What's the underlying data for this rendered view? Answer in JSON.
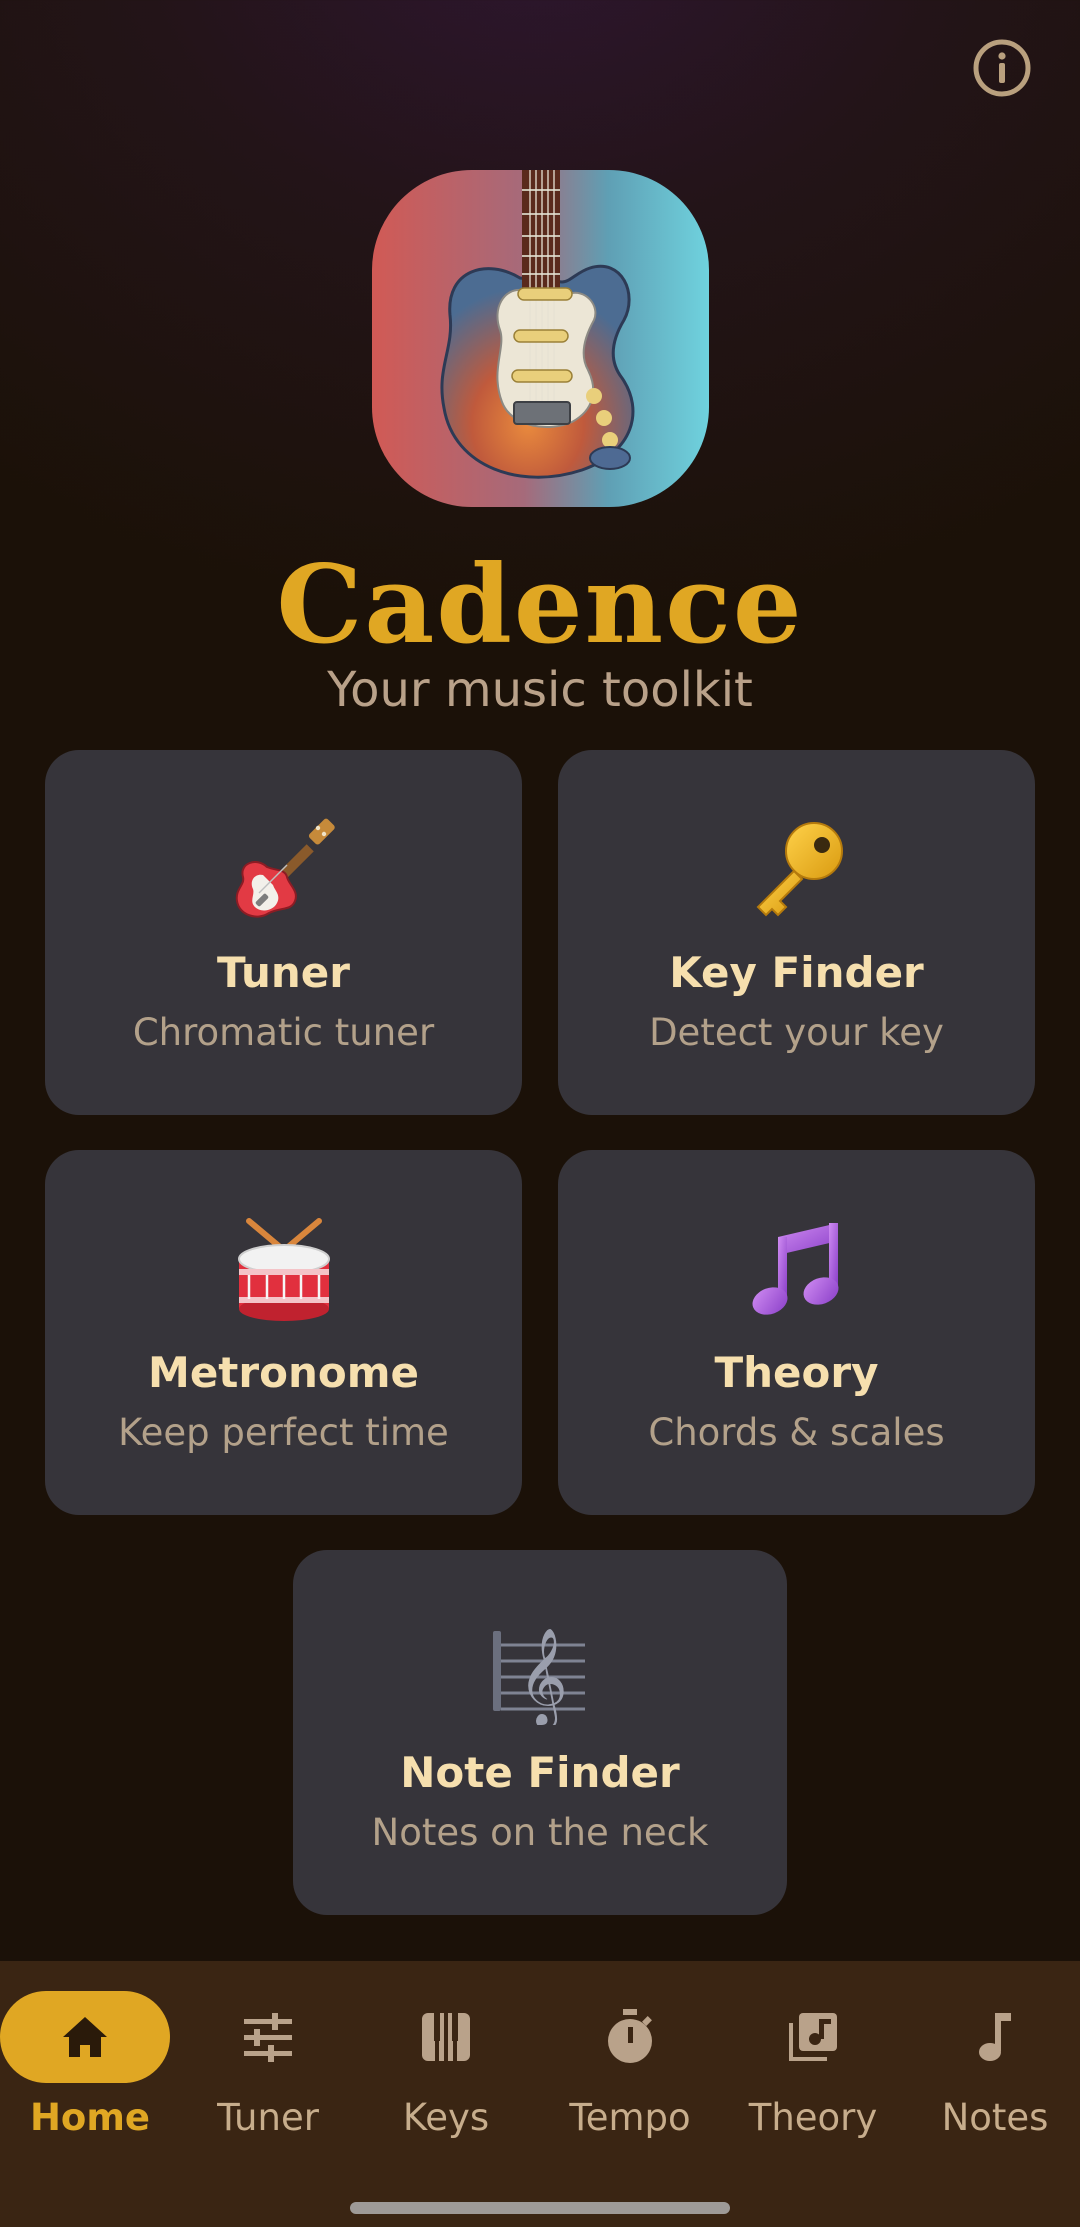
{
  "app": {
    "title": "Cadence",
    "subtitle": "Your music toolkit",
    "icon": "electric-guitar-app-icon",
    "accent_color": "#e0a723"
  },
  "header": {
    "info_icon": "info-circle-icon"
  },
  "tiles": [
    {
      "title": "Tuner",
      "subtitle": "Chromatic tuner",
      "icon": "guitar-emoji-icon"
    },
    {
      "title": "Key Finder",
      "subtitle": "Detect your key",
      "icon": "key-emoji-icon"
    },
    {
      "title": "Metronome",
      "subtitle": "Keep perfect time",
      "icon": "drum-emoji-icon"
    },
    {
      "title": "Theory",
      "subtitle": "Chords & scales",
      "icon": "music-notes-emoji-icon"
    },
    {
      "title": "Note Finder",
      "subtitle": "Notes on the neck",
      "icon": "treble-clef-icon"
    }
  ],
  "nav": {
    "active": "Home",
    "items": [
      {
        "label": "Home",
        "icon": "home-icon"
      },
      {
        "label": "Tuner",
        "icon": "sliders-icon"
      },
      {
        "label": "Keys",
        "icon": "piano-keys-icon"
      },
      {
        "label": "Tempo",
        "icon": "stopwatch-icon"
      },
      {
        "label": "Theory",
        "icon": "music-library-icon"
      },
      {
        "label": "Notes",
        "icon": "music-note-icon"
      }
    ]
  }
}
